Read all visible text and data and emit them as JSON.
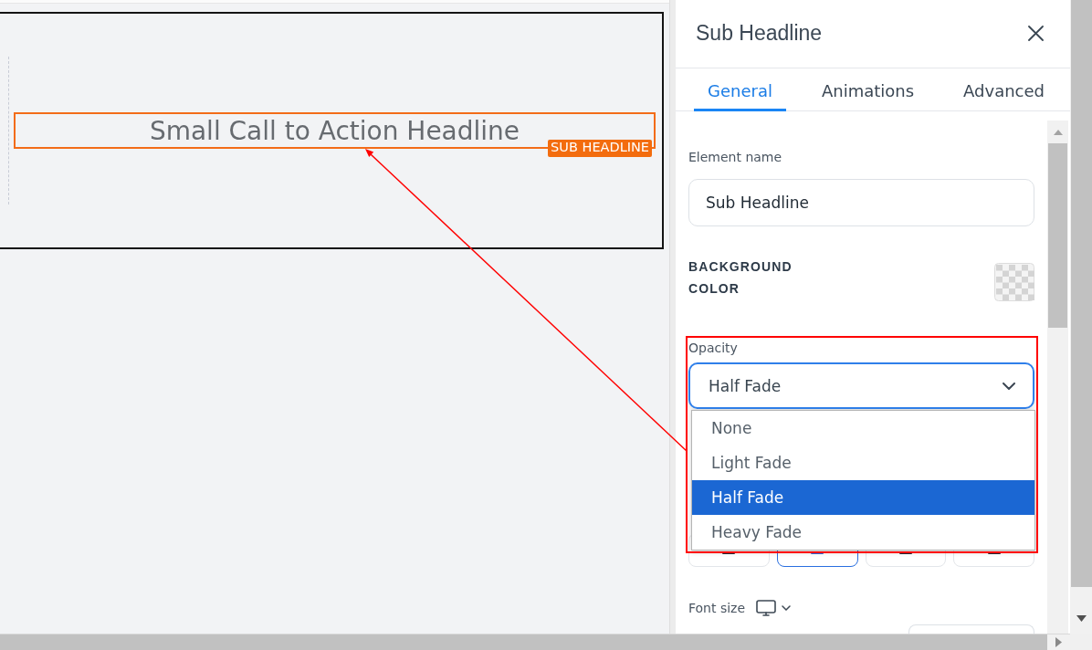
{
  "canvas": {
    "headline": {
      "text": "Small Call to Action Headline",
      "badge": "SUB HEADLINE",
      "selected": true
    }
  },
  "panel": {
    "title": "Sub Headline",
    "tabs": [
      {
        "label": "General",
        "selected": true
      },
      {
        "label": "Animations",
        "selected": false
      },
      {
        "label": "Advanced",
        "selected": false
      }
    ],
    "element_name": {
      "label": "Element name",
      "value": "Sub Headline"
    },
    "background_color": {
      "label": "BACKGROUND COLOR"
    },
    "opacity": {
      "label": "Opacity",
      "value": "Half Fade",
      "expanded": true,
      "options": [
        {
          "label": "None",
          "selected": false
        },
        {
          "label": "Light Fade",
          "selected": false
        },
        {
          "label": "Half Fade",
          "selected": true
        },
        {
          "label": "Heavy Fade",
          "selected": false
        }
      ]
    },
    "alignment_buttons": [
      {
        "selected": false
      },
      {
        "selected": true
      },
      {
        "selected": false
      },
      {
        "selected": false
      }
    ],
    "font_size": {
      "label": "Font size"
    }
  },
  "annotation": {
    "highlight_frame": true,
    "arrow": true
  }
}
